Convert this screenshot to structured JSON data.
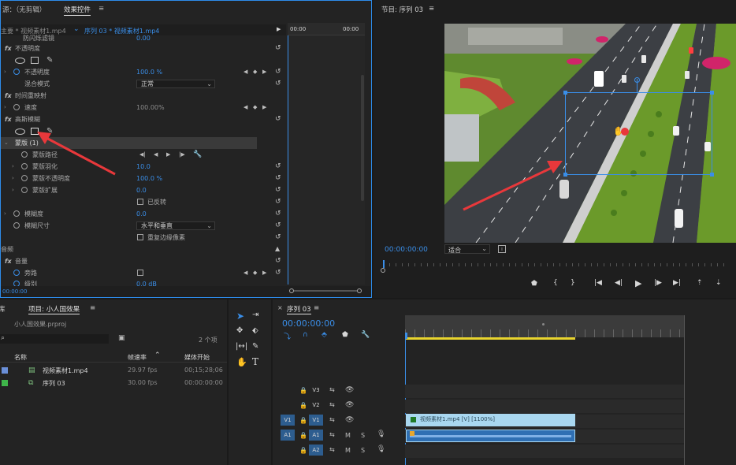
{
  "effect_controls": {
    "tab_left": "源：（无剪辑）",
    "tab_active": "效果控件",
    "tab_menu": "≡",
    "master": "主要 * 视频素材1.mp4",
    "sequence_clip": "序列 03 * 视频素材1.mp4",
    "ruler_left": "00:00",
    "ruler_right": "00:00",
    "clipped_top": "防闪烁滤镜",
    "clipped_top_val": "0.00",
    "opacity_section": "不透明度",
    "opacity_label": "不透明度",
    "opacity_value": "100.0 %",
    "blend_label": "混合模式",
    "blend_value": "正常",
    "time_remap": "时间重映射",
    "speed_label": "速度",
    "speed_value": "100.00%",
    "gaussian_blur": "高斯模糊",
    "mask_label": "蒙版 (1)",
    "mask_path": "蒙版路径",
    "mask_feather": "蒙版羽化",
    "mask_feather_val": "10.0",
    "mask_opacity": "蒙版不透明度",
    "mask_opacity_val": "100.0 %",
    "mask_expand": "蒙版扩展",
    "mask_expand_val": "0.0",
    "inverted": "已反转",
    "blurriness": "模糊度",
    "blurriness_val": "0.0",
    "blur_dimensions": "模糊尺寸",
    "blur_dim_value": "水平和垂直",
    "repeat_edge": "重复边缘像素",
    "audio_section": "音频",
    "volume_section": "音量",
    "bypass": "旁路",
    "level_label": "级别",
    "level_val": "0.0 dB",
    "timecode_bottom": "00:00:00"
  },
  "program": {
    "title": "节目: 序列 03",
    "menu": "≡",
    "timecode": "00:00:00:00",
    "fit": "适合"
  },
  "project": {
    "title": "项目: 小人国效果",
    "menu": "≡",
    "filename": "小人国效果.prproj",
    "items_count": "2 个项",
    "col_name": "名称",
    "col_fps": "帧速率",
    "col_media_start": "媒体开始",
    "rows": [
      {
        "name": "视频素材1.mp4",
        "fps": "29.97 fps",
        "start": "00;15;28;06",
        "color": "#6a8fd8"
      },
      {
        "name": "序列 03",
        "fps": "30.00 fps",
        "start": "00:00:00:00",
        "color": "#3fb54a"
      }
    ]
  },
  "timeline": {
    "title": "序列 03",
    "menu": "≡",
    "timecode": "00:00:00:00",
    "tracks": [
      {
        "left": "",
        "name": "V3"
      },
      {
        "left": "",
        "name": "V2"
      },
      {
        "left": "V1",
        "name": "V1"
      },
      {
        "left": "A1",
        "name": "A1"
      },
      {
        "left": "",
        "name": "A2"
      }
    ],
    "clip_label": "视频素材1.mp4 [V] [1100%]",
    "m_label": "M",
    "s_label": "S"
  },
  "colors": {
    "accent_blue": "#2d8ceb",
    "clip_video": "#a9d7f0",
    "clip_audio": "#2f6fb3",
    "arrow_red": "#e8383b"
  }
}
